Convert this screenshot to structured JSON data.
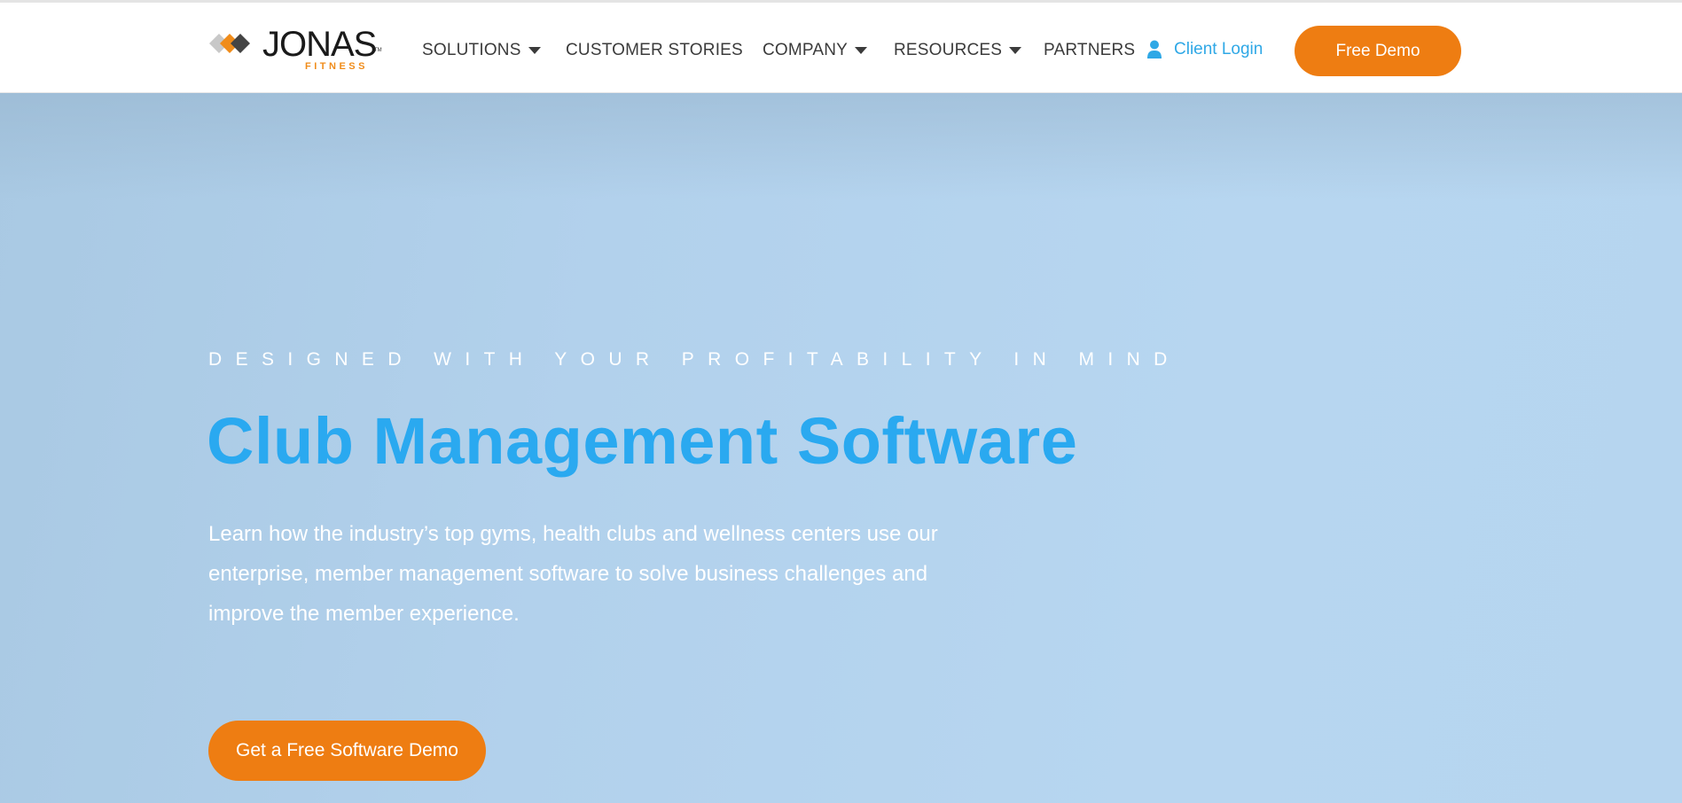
{
  "brand": {
    "name": "JONAS",
    "sub": "FITNESS",
    "tm": "TM",
    "accent_color": "#ee7d12",
    "link_color": "#2fa8e6",
    "title_color": "#2aa9f0"
  },
  "nav": {
    "items": [
      {
        "label": "SOLUTIONS",
        "dropdown": true
      },
      {
        "label": "CUSTOMER STORIES",
        "dropdown": false
      },
      {
        "label": "COMPANY",
        "dropdown": true
      },
      {
        "label": "RESOURCES",
        "dropdown": true
      },
      {
        "label": "PARTNERS",
        "dropdown": false
      }
    ],
    "login_label": "Client Login",
    "login_icon": "user-icon",
    "demo_label": "Free Demo"
  },
  "hero": {
    "eyebrow": "DESIGNED WITH YOUR PROFITABILITY IN MIND",
    "title": "Club Management Software",
    "lead": "Learn how the industry’s top gyms, health clubs and wellness centers use our enterprise, member management software to solve business challenges and improve the member experience.",
    "cta_label": "Get a Free Software Demo"
  }
}
